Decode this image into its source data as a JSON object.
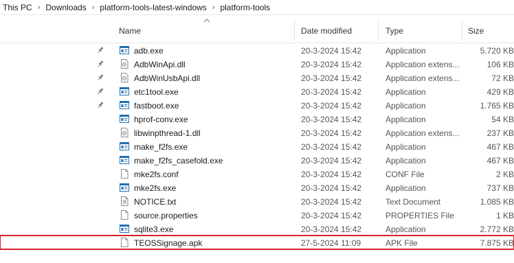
{
  "breadcrumb": [
    "This PC",
    "Downloads",
    "platform-tools-latest-windows",
    "platform-tools"
  ],
  "columns": {
    "name": "Name",
    "date": "Date modified",
    "type": "Type",
    "size": "Size"
  },
  "files": [
    {
      "name": "adb.exe",
      "date": "20-3-2024 15:42",
      "type": "Application",
      "size": "5.720 KB",
      "icon": "application-icon",
      "pinned": true
    },
    {
      "name": "AdbWinApi.dll",
      "date": "20-3-2024 15:42",
      "type": "Application extens...",
      "size": "106 KB",
      "icon": "dll-icon",
      "pinned": true
    },
    {
      "name": "AdbWinUsbApi.dll",
      "date": "20-3-2024 15:42",
      "type": "Application extens...",
      "size": "72 KB",
      "icon": "dll-icon",
      "pinned": true
    },
    {
      "name": "etc1tool.exe",
      "date": "20-3-2024 15:42",
      "type": "Application",
      "size": "429 KB",
      "icon": "application-icon",
      "pinned": true
    },
    {
      "name": "fastboot.exe",
      "date": "20-3-2024 15:42",
      "type": "Application",
      "size": "1.765 KB",
      "icon": "application-icon",
      "pinned": true
    },
    {
      "name": "hprof-conv.exe",
      "date": "20-3-2024 15:42",
      "type": "Application",
      "size": "54 KB",
      "icon": "application-icon",
      "pinned": false
    },
    {
      "name": "libwinpthread-1.dll",
      "date": "20-3-2024 15:42",
      "type": "Application extens...",
      "size": "237 KB",
      "icon": "dll-icon",
      "pinned": false
    },
    {
      "name": "make_f2fs.exe",
      "date": "20-3-2024 15:42",
      "type": "Application",
      "size": "467 KB",
      "icon": "application-icon",
      "pinned": false
    },
    {
      "name": "make_f2fs_casefold.exe",
      "date": "20-3-2024 15:42",
      "type": "Application",
      "size": "467 KB",
      "icon": "application-icon",
      "pinned": false
    },
    {
      "name": "mke2fs.conf",
      "date": "20-3-2024 15:42",
      "type": "CONF File",
      "size": "2 KB",
      "icon": "document-icon",
      "pinned": false
    },
    {
      "name": "mke2fs.exe",
      "date": "20-3-2024 15:42",
      "type": "Application",
      "size": "737 KB",
      "icon": "application-icon",
      "pinned": false
    },
    {
      "name": "NOTICE.txt",
      "date": "20-3-2024 15:42",
      "type": "Text Document",
      "size": "1.085 KB",
      "icon": "text-document-icon",
      "pinned": false
    },
    {
      "name": "source.properties",
      "date": "20-3-2024 15:42",
      "type": "PROPERTIES File",
      "size": "1 KB",
      "icon": "document-icon",
      "pinned": false
    },
    {
      "name": "sqlite3.exe",
      "date": "20-3-2024 15:42",
      "type": "Application",
      "size": "2.772 KB",
      "icon": "application-icon",
      "pinned": false
    },
    {
      "name": "TEOSSignage.apk",
      "date": "27-5-2024 11:09",
      "type": "APK File",
      "size": "7.875 KB",
      "icon": "document-icon",
      "pinned": false,
      "highlighted": true
    }
  ],
  "colors": {
    "highlight_border": "#d2232a",
    "app_icon_blue": "#1f6fb5"
  }
}
